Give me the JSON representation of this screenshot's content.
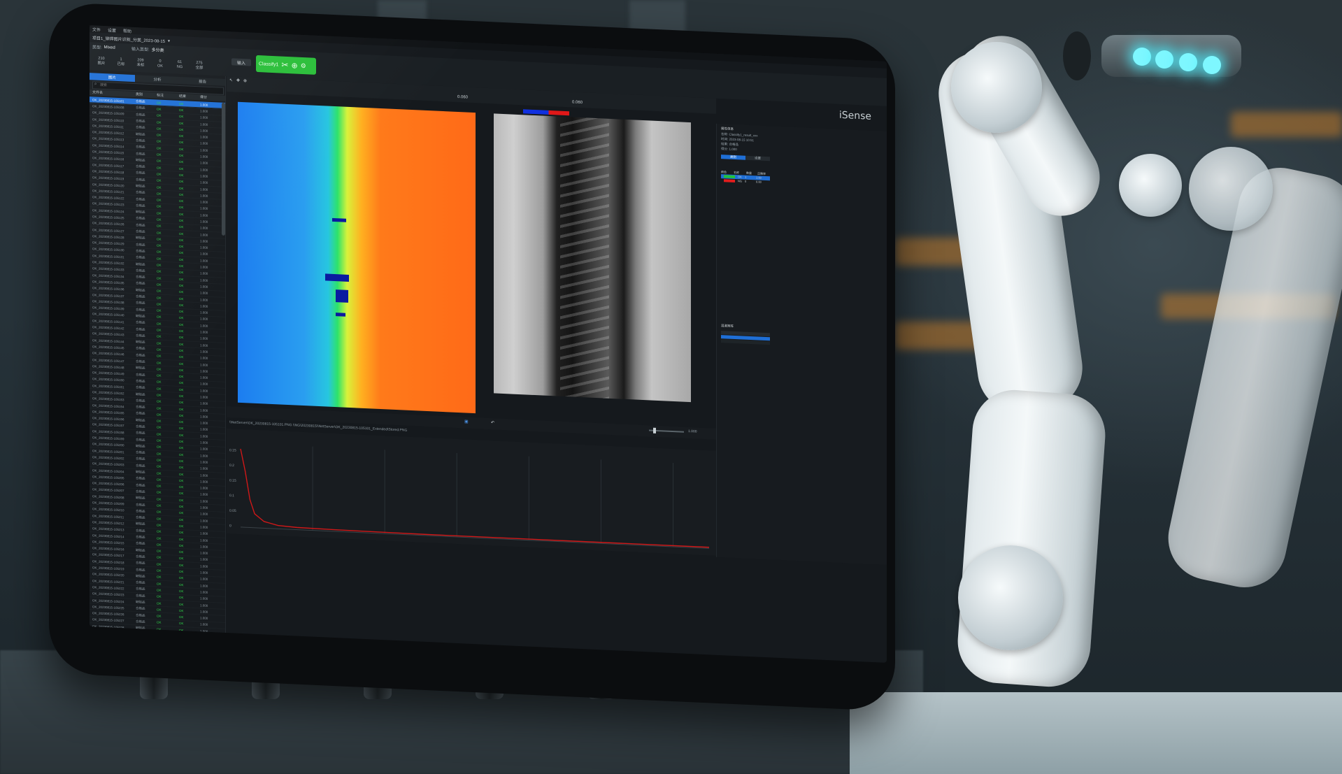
{
  "menu": [
    "文件",
    "设置",
    "帮助"
  ],
  "title": "项目1_铆焊图片识别_分类_2023-08-15",
  "toolbar": {
    "mode_label": "类型:",
    "mode_value": "Mixed",
    "input_type_label": "输入类型:",
    "input_type_value": "多分类",
    "input_button": "输入",
    "classify_button": "Classify1"
  },
  "stats": [
    {
      "value": "210",
      "label": "图片"
    },
    {
      "value": "1",
      "label": "已标"
    },
    {
      "value": "209",
      "label": "未标"
    },
    {
      "value": "0",
      "label": "OK"
    },
    {
      "value": "61",
      "label": "NG"
    },
    {
      "value": "275",
      "label": "全部"
    }
  ],
  "brand": "iSense",
  "left_panel": {
    "tabs": [
      "图片",
      "分析",
      "报告"
    ],
    "search_placeholder": "搜索",
    "columns": [
      "文件名",
      "类别",
      "标注",
      "结果",
      "得分"
    ],
    "rows": [
      {
        "name": "OK_20230815-105101",
        "cls": "合格品",
        "a": "OK",
        "b": "OK",
        "v": "1.000",
        "selected": true
      },
      {
        "name": "OK_20230815-105108",
        "cls": "合格品",
        "a": "OK",
        "b": "OK",
        "v": "1.000"
      },
      {
        "name": "OK_20230815-105109",
        "cls": "合格品",
        "a": "OK",
        "b": "OK",
        "v": "1.000"
      },
      {
        "name": "OK_20230815-105110",
        "cls": "合格品",
        "a": "OK",
        "b": "OK",
        "v": "1.000"
      },
      {
        "name": "OK_20230815-105111",
        "cls": "合格品",
        "a": "OK",
        "b": "OK",
        "v": "1.000"
      },
      {
        "name": "OK_20230815-105112",
        "cls": "缺陷品",
        "a": "OK",
        "b": "OK",
        "v": "1.000"
      },
      {
        "name": "OK_20230815-105113",
        "cls": "合格品",
        "a": "OK",
        "b": "OK",
        "v": "1.000"
      },
      {
        "name": "OK_20230815-105114",
        "cls": "合格品",
        "a": "OK",
        "b": "OK",
        "v": "1.000"
      },
      {
        "name": "OK_20230815-105115",
        "cls": "合格品",
        "a": "OK",
        "b": "OK",
        "v": "1.000"
      },
      {
        "name": "OK_20230815-105116",
        "cls": "缺陷品",
        "a": "OK",
        "b": "OK",
        "v": "1.000"
      },
      {
        "name": "OK_20230815-105117",
        "cls": "合格品",
        "a": "OK",
        "b": "OK",
        "v": "1.000"
      },
      {
        "name": "OK_20230815-105118",
        "cls": "合格品",
        "a": "OK",
        "b": "OK",
        "v": "1.000"
      },
      {
        "name": "OK_20230815-105119",
        "cls": "合格品",
        "a": "OK",
        "b": "OK",
        "v": "1.000"
      },
      {
        "name": "OK_20230815-105120",
        "cls": "缺陷品",
        "a": "OK",
        "b": "OK",
        "v": "1.000"
      },
      {
        "name": "OK_20230815-105121",
        "cls": "合格品",
        "a": "OK",
        "b": "OK",
        "v": "1.000"
      },
      {
        "name": "OK_20230815-105122",
        "cls": "合格品",
        "a": "OK",
        "b": "OK",
        "v": "1.000"
      },
      {
        "name": "OK_20230815-105123",
        "cls": "合格品",
        "a": "OK",
        "b": "OK",
        "v": "1.000"
      },
      {
        "name": "OK_20230815-105124",
        "cls": "缺陷品",
        "a": "OK",
        "b": "OK",
        "v": "1.000"
      },
      {
        "name": "OK_20230815-105125",
        "cls": "合格品",
        "a": "OK",
        "b": "OK",
        "v": "1.000"
      },
      {
        "name": "OK_20230815-105126",
        "cls": "合格品",
        "a": "OK",
        "b": "OK",
        "v": "1.000"
      },
      {
        "name": "OK_20230815-105127",
        "cls": "合格品",
        "a": "OK",
        "b": "OK",
        "v": "1.000"
      },
      {
        "name": "OK_20230815-105128",
        "cls": "缺陷品",
        "a": "OK",
        "b": "OK",
        "v": "1.000"
      },
      {
        "name": "OK_20230815-105129",
        "cls": "合格品",
        "a": "OK",
        "b": "OK",
        "v": "1.000"
      },
      {
        "name": "OK_20230815-105130",
        "cls": "合格品",
        "a": "OK",
        "b": "OK",
        "v": "1.000"
      },
      {
        "name": "OK_20230815-105131",
        "cls": "合格品",
        "a": "OK",
        "b": "OK",
        "v": "1.000"
      },
      {
        "name": "OK_20230815-105132",
        "cls": "缺陷品",
        "a": "OK",
        "b": "OK",
        "v": "1.000"
      },
      {
        "name": "OK_20230815-105133",
        "cls": "合格品",
        "a": "OK",
        "b": "OK",
        "v": "1.000"
      },
      {
        "name": "OK_20230815-105134",
        "cls": "合格品",
        "a": "OK",
        "b": "OK",
        "v": "1.000"
      },
      {
        "name": "OK_20230815-105135",
        "cls": "合格品",
        "a": "OK",
        "b": "OK",
        "v": "1.000"
      },
      {
        "name": "OK_20230815-105136",
        "cls": "缺陷品",
        "a": "OK",
        "b": "OK",
        "v": "1.000"
      },
      {
        "name": "OK_20230815-105137",
        "cls": "合格品",
        "a": "OK",
        "b": "OK",
        "v": "1.000"
      },
      {
        "name": "OK_20230815-105138",
        "cls": "合格品",
        "a": "OK",
        "b": "OK",
        "v": "1.000"
      },
      {
        "name": "OK_20230815-105139",
        "cls": "合格品",
        "a": "OK",
        "b": "OK",
        "v": "1.000"
      },
      {
        "name": "OK_20230815-105140",
        "cls": "缺陷品",
        "a": "OK",
        "b": "OK",
        "v": "1.000"
      },
      {
        "name": "OK_20230815-105141",
        "cls": "合格品",
        "a": "OK",
        "b": "OK",
        "v": "1.000"
      },
      {
        "name": "OK_20230815-105142",
        "cls": "合格品",
        "a": "OK",
        "b": "OK",
        "v": "1.000"
      },
      {
        "name": "OK_20230815-105143",
        "cls": "合格品",
        "a": "OK",
        "b": "OK",
        "v": "1.000"
      },
      {
        "name": "OK_20230815-105144",
        "cls": "缺陷品",
        "a": "OK",
        "b": "OK",
        "v": "1.000"
      },
      {
        "name": "OK_20230815-105145",
        "cls": "合格品",
        "a": "OK",
        "b": "OK",
        "v": "1.000"
      },
      {
        "name": "OK_20230815-105146",
        "cls": "合格品",
        "a": "OK",
        "b": "OK",
        "v": "1.000"
      },
      {
        "name": "OK_20230815-105147",
        "cls": "合格品",
        "a": "OK",
        "b": "OK",
        "v": "1.000"
      },
      {
        "name": "OK_20230815-105148",
        "cls": "缺陷品",
        "a": "OK",
        "b": "OK",
        "v": "1.000"
      },
      {
        "name": "OK_20230815-105149",
        "cls": "合格品",
        "a": "OK",
        "b": "OK",
        "v": "1.000"
      },
      {
        "name": "OK_20230815-105150",
        "cls": "合格品",
        "a": "OK",
        "b": "OK",
        "v": "1.000"
      },
      {
        "name": "OK_20230815-105151",
        "cls": "合格品",
        "a": "OK",
        "b": "OK",
        "v": "1.000"
      },
      {
        "name": "OK_20230815-105152",
        "cls": "缺陷品",
        "a": "OK",
        "b": "OK",
        "v": "1.000"
      },
      {
        "name": "OK_20230815-105153",
        "cls": "合格品",
        "a": "OK",
        "b": "OK",
        "v": "1.000"
      },
      {
        "name": "OK_20230815-105154",
        "cls": "合格品",
        "a": "OK",
        "b": "OK",
        "v": "1.000"
      },
      {
        "name": "OK_20230815-105155",
        "cls": "合格品",
        "a": "OK",
        "b": "OK",
        "v": "1.000"
      },
      {
        "name": "OK_20230815-105156",
        "cls": "缺陷品",
        "a": "OK",
        "b": "OK",
        "v": "1.000"
      },
      {
        "name": "OK_20230815-105157",
        "cls": "合格品",
        "a": "OK",
        "b": "OK",
        "v": "1.000"
      },
      {
        "name": "OK_20230815-105158",
        "cls": "合格品",
        "a": "OK",
        "b": "OK",
        "v": "1.000"
      },
      {
        "name": "OK_20230815-105159",
        "cls": "合格品",
        "a": "OK",
        "b": "OK",
        "v": "1.000"
      },
      {
        "name": "OK_20230815-105200",
        "cls": "缺陷品",
        "a": "OK",
        "b": "OK",
        "v": "1.000"
      },
      {
        "name": "OK_20230815-105201",
        "cls": "合格品",
        "a": "OK",
        "b": "OK",
        "v": "1.000"
      },
      {
        "name": "OK_20230815-105202",
        "cls": "合格品",
        "a": "OK",
        "b": "OK",
        "v": "1.000"
      },
      {
        "name": "OK_20230815-105203",
        "cls": "合格品",
        "a": "OK",
        "b": "OK",
        "v": "1.000"
      },
      {
        "name": "OK_20230815-105204",
        "cls": "缺陷品",
        "a": "OK",
        "b": "OK",
        "v": "1.000"
      },
      {
        "name": "OK_20230815-105205",
        "cls": "合格品",
        "a": "OK",
        "b": "OK",
        "v": "1.000"
      },
      {
        "name": "OK_20230815-105206",
        "cls": "合格品",
        "a": "OK",
        "b": "OK",
        "v": "1.000"
      },
      {
        "name": "OK_20230815-105207",
        "cls": "合格品",
        "a": "OK",
        "b": "OK",
        "v": "1.000"
      },
      {
        "name": "OK_20230815-105208",
        "cls": "缺陷品",
        "a": "OK",
        "b": "OK",
        "v": "1.000"
      },
      {
        "name": "OK_20230815-105209",
        "cls": "合格品",
        "a": "OK",
        "b": "OK",
        "v": "1.000"
      },
      {
        "name": "OK_20230815-105210",
        "cls": "合格品",
        "a": "OK",
        "b": "OK",
        "v": "1.000"
      },
      {
        "name": "OK_20230815-105211",
        "cls": "合格品",
        "a": "OK",
        "b": "OK",
        "v": "1.000"
      },
      {
        "name": "OK_20230815-105212",
        "cls": "缺陷品",
        "a": "OK",
        "b": "OK",
        "v": "1.000"
      },
      {
        "name": "OK_20230815-105213",
        "cls": "合格品",
        "a": "OK",
        "b": "OK",
        "v": "1.000"
      },
      {
        "name": "OK_20230815-105214",
        "cls": "合格品",
        "a": "OK",
        "b": "OK",
        "v": "1.000"
      },
      {
        "name": "OK_20230815-105215",
        "cls": "合格品",
        "a": "OK",
        "b": "OK",
        "v": "1.000"
      },
      {
        "name": "OK_20230815-105216",
        "cls": "缺陷品",
        "a": "OK",
        "b": "OK",
        "v": "1.000"
      },
      {
        "name": "OK_20230815-105217",
        "cls": "合格品",
        "a": "OK",
        "b": "OK",
        "v": "1.000"
      },
      {
        "name": "OK_20230815-105218",
        "cls": "合格品",
        "a": "OK",
        "b": "OK",
        "v": "1.000"
      },
      {
        "name": "OK_20230815-105219",
        "cls": "合格品",
        "a": "OK",
        "b": "OK",
        "v": "1.000"
      },
      {
        "name": "OK_20230815-105220",
        "cls": "缺陷品",
        "a": "OK",
        "b": "OK",
        "v": "1.000"
      },
      {
        "name": "OK_20230815-105221",
        "cls": "合格品",
        "a": "OK",
        "b": "OK",
        "v": "1.000"
      },
      {
        "name": "OK_20230815-105222",
        "cls": "合格品",
        "a": "OK",
        "b": "OK",
        "v": "1.000"
      },
      {
        "name": "OK_20230815-105223",
        "cls": "合格品",
        "a": "OK",
        "b": "OK",
        "v": "1.000"
      },
      {
        "name": "OK_20230815-105224",
        "cls": "缺陷品",
        "a": "OK",
        "b": "OK",
        "v": "1.000"
      },
      {
        "name": "OK_20230815-105225",
        "cls": "合格品",
        "a": "OK",
        "b": "OK",
        "v": "1.000"
      },
      {
        "name": "OK_20230815-105226",
        "cls": "合格品",
        "a": "OK",
        "b": "OK",
        "v": "1.000"
      },
      {
        "name": "OK_20230815-105227",
        "cls": "合格品",
        "a": "OK",
        "b": "OK",
        "v": "1.000"
      },
      {
        "name": "OK_20230815-105228",
        "cls": "缺陷品",
        "a": "OK",
        "b": "OK",
        "v": "1.000"
      },
      {
        "name": "OK_20230815-105229",
        "cls": "合格品",
        "a": "OK",
        "b": "OK",
        "v": "1.000"
      },
      {
        "name": "OK_20230815-105230",
        "cls": "合格品",
        "a": "OK",
        "b": "OK",
        "v": "1.000"
      },
      {
        "name": "OK_20230815-105231",
        "cls": "合格品",
        "a": "OK",
        "b": "OK",
        "v": "1.000"
      },
      {
        "name": "OK_20230815-105232",
        "cls": "缺陷品",
        "a": "OK",
        "b": "OK",
        "v": "1.000"
      },
      {
        "name": "OK_20230815-105233",
        "cls": "合格品",
        "a": "OK",
        "b": "OK",
        "v": "1.000"
      },
      {
        "name": "OK_20230815-105234",
        "cls": "合格品",
        "a": "OK",
        "b": "OK",
        "v": "1.000"
      },
      {
        "name": "OK_20230815-105235",
        "cls": "合格品",
        "a": "OK",
        "b": "OK",
        "v": "1.000"
      },
      {
        "name": "OK_20230815-105236",
        "cls": "缺陷品",
        "a": "OK",
        "b": "OK",
        "v": "1.000"
      }
    ]
  },
  "viewer": {
    "zoom_value": "1.000",
    "score_value": "0.060",
    "path_text": "\\\\NetServer\\OK_20230815-105101.PNG \\\\NG\\20230815\\\\NetServer\\OK_20230815-105101_Extended\\Stored.PNG"
  },
  "right_panel": {
    "section_title": "属性信息",
    "info": [
      "名称: Classify1_result_xxx",
      "时间: 2023-08-15 10:51",
      "结果: 合格品",
      "得分: 1.000"
    ],
    "tabs": [
      "类别",
      "设置"
    ],
    "class_header": [
      "颜色",
      "名称",
      "数量",
      "正确率"
    ],
    "classes": [
      {
        "color": "#22c33a",
        "name": "OK",
        "n": "1",
        "r": "1.00"
      },
      {
        "color": "#e21d1d",
        "name": "NG",
        "n": "0",
        "r": "0.00"
      }
    ],
    "matrix_title": "混淆矩阵"
  },
  "chart_data": {
    "type": "line",
    "x": [
      0,
      0.01,
      0.02,
      0.03,
      0.05,
      0.08,
      0.12,
      0.2,
      0.4,
      0.7,
      1.0
    ],
    "series": [
      {
        "values": [
          0.14,
          0.1,
          0.05,
          0.025,
          0.012,
          0.006,
          0.004,
          0.003,
          0.002,
          0.002,
          0.002
        ]
      }
    ],
    "ylim": [
      0,
      0.15
    ],
    "ytick_labels": [
      "0.15",
      "0.2",
      "0.15",
      "0.1",
      "0.05",
      "0"
    ],
    "series_color": "#d01818",
    "grid": true
  },
  "colors": {
    "accent": "#1f6fd6",
    "classify": "#2bbf3a",
    "ok": "#2fd14a",
    "ng": "#e21d1d"
  }
}
